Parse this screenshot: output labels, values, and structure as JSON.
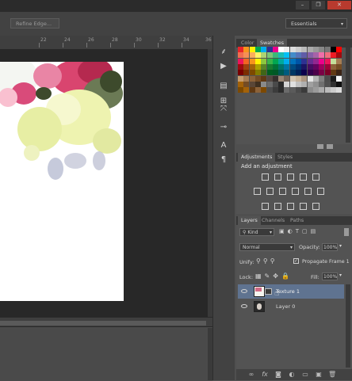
{
  "window": {
    "buttons": [
      "–",
      "❐",
      "✕"
    ]
  },
  "options_bar": {
    "refine_edge_label": "Refine Edge...",
    "workspace_label": "Essentials"
  },
  "ruler": {
    "ticks": [
      "22",
      "24",
      "26",
      "28",
      "30",
      "32",
      "34",
      "36"
    ]
  },
  "tools": [
    "icon-brush",
    "icon-play",
    "icon-history",
    "icon-clone",
    "icon-move-tool",
    "icon-measure",
    "icon-character",
    "icon-paragraph"
  ],
  "color_panel": {
    "tabs": [
      "Color",
      "Swatches"
    ],
    "active_tab": "Swatches",
    "swatch_rows": [
      [
        "#e8242a",
        "#f7941d",
        "#fff200",
        "#00a651",
        "#00aeef",
        "#2e3192",
        "#ec008c",
        "#ffffff",
        "#eeeeee",
        "#dddddd",
        "#cccccc",
        "#bbbbbb",
        "#aaaaaa",
        "#999999",
        "#888888",
        "#777777",
        "#000000",
        "#ff0000"
      ],
      [
        "#f26c4f",
        "#f68e55",
        "#fbaf5c",
        "#fff467",
        "#acd372",
        "#7cc576",
        "#3bb878",
        "#1abbb4",
        "#00bff3",
        "#438cca",
        "#5574b9",
        "#605ca8",
        "#855fa8",
        "#a763a8",
        "#f06ea9",
        "#f26d7d",
        "#ed1c24",
        "#9e0b0f"
      ],
      [
        "#ed145b",
        "#f26522",
        "#f7941d",
        "#fff200",
        "#8dc73f",
        "#39b54a",
        "#00a651",
        "#00a99d",
        "#00aeef",
        "#0072bc",
        "#0054a6",
        "#2e3192",
        "#662d91",
        "#92278f",
        "#ec008c",
        "#ed145b",
        "#c4df9b",
        "#a67c52"
      ],
      [
        "#9e0b0f",
        "#a0410d",
        "#a36209",
        "#aba000",
        "#598527",
        "#1a7b30",
        "#007236",
        "#00746b",
        "#0076a3",
        "#004b80",
        "#003471",
        "#1b1464",
        "#440e62",
        "#630460",
        "#9e005d",
        "#9e0039",
        "#8c6239",
        "#754c24"
      ],
      [
        "#790000",
        "#7b2e00",
        "#7d4900",
        "#827b00",
        "#406618",
        "#005e20",
        "#005826",
        "#005952",
        "#005b7f",
        "#003663",
        "#002157",
        "#0d004c",
        "#32004b",
        "#4b0049",
        "#7b0046",
        "#7a0026",
        "#603913",
        "#3c2415"
      ],
      [
        "#c69c6d",
        "#a67c52",
        "#8c6239",
        "#754c24",
        "#603913",
        "#534741",
        "#362f2d",
        "#998675",
        "#736357",
        "#d2c4b2",
        "#c7b299",
        "#ab9581",
        "#e6e6e6",
        "#b3b3b3",
        "#808080",
        "#4d4d4d",
        "#1a1a1a",
        "#f5f5f5"
      ],
      [
        "#a36209",
        "#754c24",
        "#5a4636",
        "#403020",
        "#8a8a8a",
        "#6a6a6a",
        "#4a4a4a",
        "#2a2a2a",
        "#d4d4d4",
        "#e0e0e0",
        "#c0c0c0",
        "#b0b0b0",
        "#a0a0a0",
        "#909090",
        "#707070",
        "#505050",
        "#303030",
        "#101010"
      ],
      [
        "#7d4900",
        "#a36209",
        "#603913",
        "#8c6239",
        "#7d4900",
        "#4d4d4d",
        "#3c3c3c",
        "#2c2c2c",
        "#6b6b6b",
        "#5b5b5b",
        "#4b4b4b",
        "#3b3b3b",
        "#8b8b8b",
        "#9b9b9b",
        "#ababab",
        "#bbbbbb",
        "#cbcbcb",
        "#dbdbdb"
      ]
    ]
  },
  "adjustments_panel": {
    "tabs": [
      "Adjustments",
      "Styles"
    ],
    "active_tab": "Adjustments",
    "heading": "Add an adjustment",
    "icons_row1": [
      "brightness-icon",
      "levels-icon",
      "curves-icon",
      "exposure-icon",
      "vibrance-icon"
    ],
    "icons_row2": [
      "hue-saturation-icon",
      "color-balance-icon",
      "black-white-icon",
      "photo-filter-icon",
      "channel-mixer-icon",
      "color-lookup-icon"
    ],
    "icons_row3": [
      "invert-icon",
      "posterize-icon",
      "threshold-icon",
      "gradient-map-icon",
      "selective-color-icon"
    ]
  },
  "layers_panel": {
    "tabs": [
      "Layers",
      "Channels",
      "Paths"
    ],
    "active_tab": "Layers",
    "filter_kind": "Kind",
    "blend_mode": "Normal",
    "opacity_label": "Opacity:",
    "opacity_value": "100%",
    "unify_label": "Unify:",
    "propagate_label": "Propagate Frame 1",
    "lock_label": "Lock:",
    "fill_label": "Fill:",
    "fill_value": "100%",
    "layers": [
      {
        "name": "Texture 1",
        "selected": true
      },
      {
        "name": "Layer 0",
        "selected": false
      }
    ],
    "bottom_icons": [
      "link-icon",
      "fx-icon",
      "mask-icon",
      "adjustment-layer-icon",
      "group-icon",
      "new-layer-icon",
      "trash-icon"
    ]
  }
}
